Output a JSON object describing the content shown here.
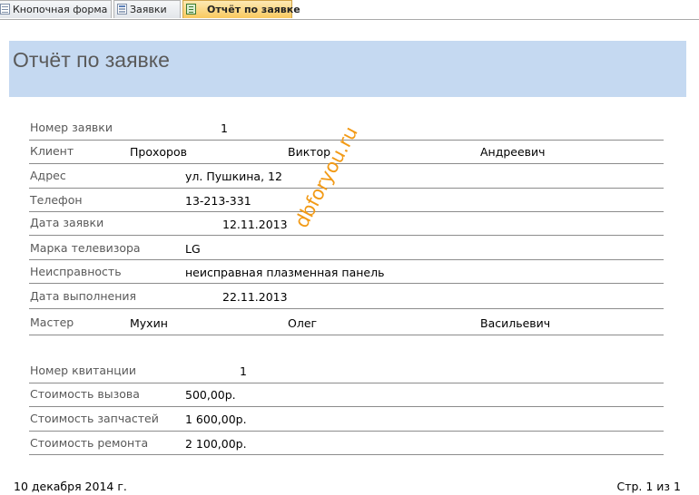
{
  "tabs": [
    {
      "label": "Кнопочная форма",
      "icon": "form-icon",
      "active": false
    },
    {
      "label": "Заявки",
      "icon": "table-icon",
      "active": false
    },
    {
      "label": "Отчёт по заявке",
      "icon": "report-icon",
      "active": true
    }
  ],
  "report": {
    "title": "Отчёт по заявке",
    "order": {
      "number_label": "Номер заявки",
      "number": "1",
      "client_label": "Клиент",
      "client_last": "Прохоров",
      "client_first": "Виктор",
      "client_middle": "Андреевич",
      "address_label": "Адрес",
      "address": "ул. Пушкина, 12",
      "phone_label": "Телефон",
      "phone": "13-213-331",
      "date_label": "Дата заявки",
      "date": "12.11.2013",
      "brand_label": "Марка телевизора",
      "brand": "LG",
      "fault_label": "Неисправность",
      "fault": "неисправная плазменная панель",
      "done_label": "Дата выполнения",
      "done": "22.11.2013",
      "master_label": "Мастер",
      "master_last": "Мухин",
      "master_first": "Олег",
      "master_middle": "Васильевич"
    },
    "receipt": {
      "number_label": "Номер квитанции",
      "number": "1",
      "call_label": "Стоимость вызова",
      "call": "500,00р.",
      "parts_label": "Стоимость запчастей",
      "parts": "1 600,00р.",
      "repair_label": "Стоимость ремонта",
      "repair": "2 100,00р."
    },
    "footer": {
      "date": "10 декабря 2014 г.",
      "page": "Стр. 1 из 1"
    },
    "watermark": "dbforyou.ru"
  }
}
